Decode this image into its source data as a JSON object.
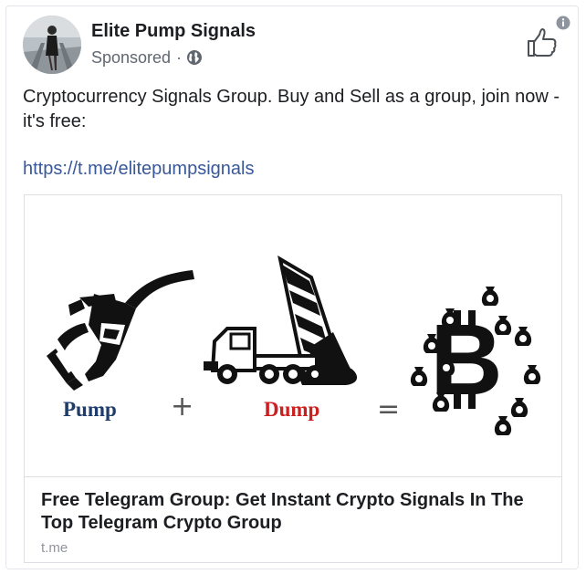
{
  "post": {
    "page_name": "Elite Pump Signals",
    "sponsored_label": "Sponsored",
    "separator": "·",
    "text": "Cryptocurrency Signals Group. Buy and Sell as a group, join now - it's free:",
    "link_text": "https://t.me/elitepumpsignals"
  },
  "preview": {
    "pump_label": "Pump",
    "plus_sign": "+",
    "dump_label": "Dump",
    "equals_sign": "=",
    "title": "Free Telegram Group: Get Instant Crypto Signals In The Top Telegram Crypto Group",
    "domain": "t.me"
  },
  "colors": {
    "link": "#385898",
    "pump_text": "#1f3d6b",
    "dump_text": "#cc2020",
    "secondary_text": "#606770"
  },
  "icons": {
    "globe": "globe-icon",
    "like": "thumbs-up-icon",
    "info": "info-icon"
  }
}
